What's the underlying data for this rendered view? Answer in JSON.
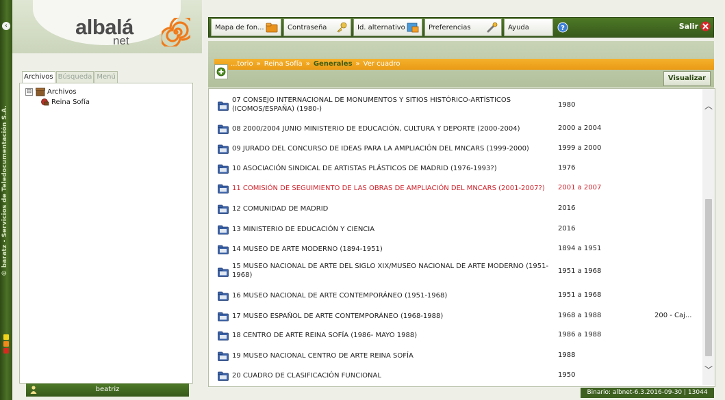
{
  "brand": {
    "logo_text": "albalá",
    "logo_subtext": "net",
    "vertical_text": "© baratz - Servicios de Teledocumentación S.A.",
    "colors": {
      "primary_green": "#4d7226",
      "dark_green": "#2e4a16",
      "accent_orange": "#f5a623",
      "highlight_red": "#d0202a"
    }
  },
  "sidebar": {
    "tabs": [
      {
        "label": "Archivos",
        "active": true
      },
      {
        "label": "Búsqueda",
        "active": false
      },
      {
        "label": "Menú",
        "active": false
      }
    ],
    "tree": {
      "root": {
        "label": "Archivos",
        "toggle": "⊟",
        "icon": "archive-box-icon"
      },
      "child": {
        "label": "Reina Sofía",
        "icon": "archive-item-icon"
      }
    },
    "user": {
      "name": "beatriz",
      "icon": "user-icon"
    }
  },
  "toolbar": {
    "buttons": [
      {
        "label": "Mapa de fon...",
        "icon": "folder-map-icon"
      },
      {
        "label": "Contraseña",
        "icon": "key-icon"
      },
      {
        "label": "Id. alternativo",
        "icon": "id-card-icon"
      },
      {
        "label": "Preferencias",
        "icon": "wrench-icon"
      },
      {
        "label": "Ayuda",
        "icon": "help-icon"
      }
    ],
    "exit_label": "Salir"
  },
  "breadcrumb": {
    "items": [
      "...torio",
      "Reina Sofía",
      "Generales",
      "Ver cuadro"
    ],
    "separator": "»"
  },
  "visualizar_label": "Visualizar",
  "list": {
    "rows": [
      {
        "title": "07 CONSEJO INTERNACIONAL DE MONUMENTOS Y SITIOS HISTÓRICO-ARTÍSTICOS (ICOMOS/ESPAÑA) (1980-)",
        "date": "1980",
        "extra": "",
        "highlight": false
      },
      {
        "title": "08 2000/2004 JUNIO MINISTERIO DE EDUCACIÓN, CULTURA Y DEPORTE (2000-2004)",
        "date": "2000 a 2004",
        "extra": "",
        "highlight": false
      },
      {
        "title": "09 JURADO DEL CONCURSO DE IDEAS PARA LA AMPLIACIÓN DEL MNCARS (1999-2000)",
        "date": "1999 a 2000",
        "extra": "",
        "highlight": false
      },
      {
        "title": "10 ASOCIACIÓN SINDICAL DE ARTISTAS PLÁSTICOS DE MADRID (1976-1993?)",
        "date": "1976",
        "extra": "",
        "highlight": false
      },
      {
        "title": "11 COMISIÓN DE SEGUIMIENTO DE LAS OBRAS DE AMPLIACIÓN DEL MNCARS (2001-2007?)",
        "date": "2001 a 2007",
        "extra": "",
        "highlight": true
      },
      {
        "title": "12 COMUNIDAD DE MADRID",
        "date": "2016",
        "extra": "",
        "highlight": false
      },
      {
        "title": "13 MINISTERIO DE EDUCACIÓN Y CIENCIA",
        "date": "2016",
        "extra": "",
        "highlight": false
      },
      {
        "title": "14 MUSEO DE ARTE MODERNO (1894-1951)",
        "date": "1894 a 1951",
        "extra": "",
        "highlight": false
      },
      {
        "title": "15 MUSEO NACIONAL DE ARTE DEL SIGLO XIX/MUSEO NACIONAL DE ARTE MODERNO (1951-1968)",
        "date": "1951 a 1968",
        "extra": "",
        "highlight": false
      },
      {
        "title": "16 MUSEO NACIONAL DE ARTE CONTEMPORÁNEO (1951-1968)",
        "date": "1951 a 1968",
        "extra": "",
        "highlight": false
      },
      {
        "title": "17 MUSEO ESPAÑOL DE ARTE CONTEMPORÁNEO (1968-1988)",
        "date": "1968 a 1988",
        "extra": "200 - Caj...",
        "highlight": false
      },
      {
        "title": "18 CENTRO DE ARTE REINA SOFÍA (1986- MAYO 1988)",
        "date": "1986 a 1988",
        "extra": "",
        "highlight": false
      },
      {
        "title": "19 MUSEO NACIONAL CENTRO DE ARTE REINA SOFÍA",
        "date": "1988",
        "extra": "",
        "highlight": false
      },
      {
        "title": "20 CUADRO DE CLASIFICACIÓN FUNCIONAL",
        "date": "1950",
        "extra": "",
        "highlight": false
      }
    ]
  },
  "status": {
    "text": "Binario: albnet-6.3.2016-09-30 | 13044"
  }
}
